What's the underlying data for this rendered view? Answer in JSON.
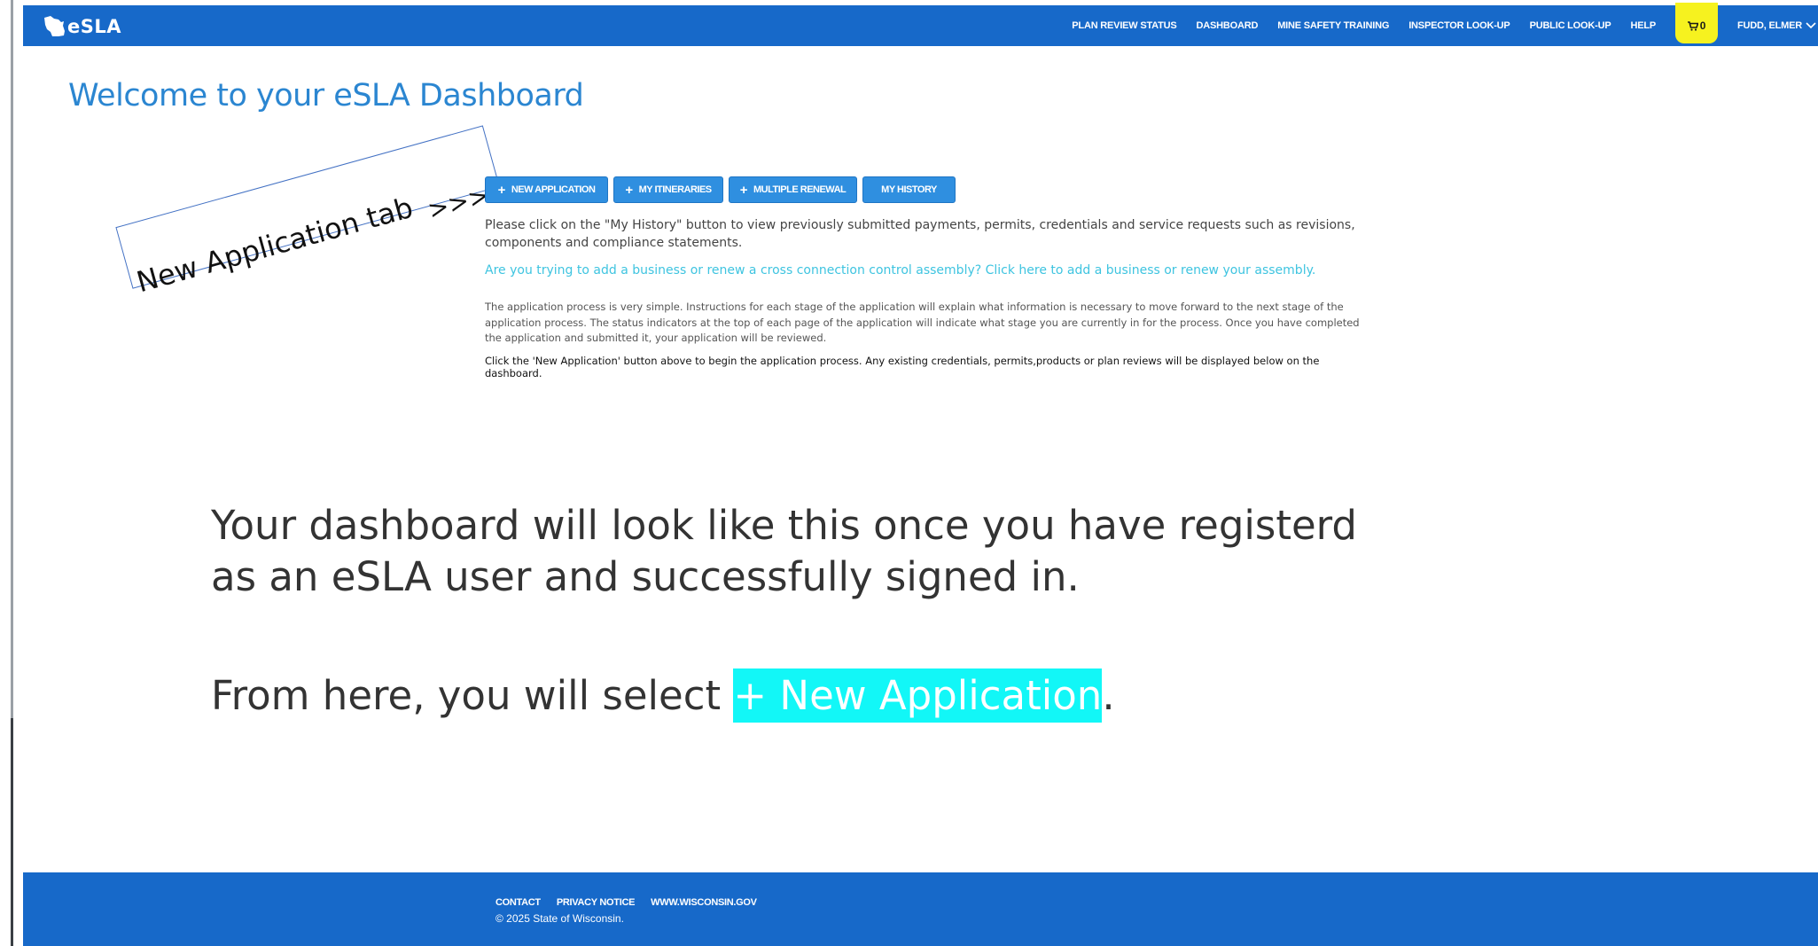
{
  "header": {
    "logo_text": "eSLA",
    "nav": [
      "PLAN REVIEW STATUS",
      "DASHBOARD",
      "MINE SAFETY TRAINING",
      "INSPECTOR LOOK-UP",
      "PUBLIC LOOK-UP",
      "HELP"
    ],
    "cart_count": "0",
    "user_name": "FUDD, ELMER",
    "brand_color": "#1769c9",
    "cart_color": "#f6f21f"
  },
  "main": {
    "title": "Welcome to your eSLA Dashboard",
    "buttons": [
      {
        "label": "NEW APPLICATION",
        "icon": "plus-icon"
      },
      {
        "label": "MY ITINERARIES",
        "icon": "plus-icon"
      },
      {
        "label": "MULTIPLE RENEWAL",
        "icon": "plus-icon"
      },
      {
        "label": "MY HISTORY",
        "icon": ""
      }
    ],
    "history_text": "Please click on the \"My History\" button to view previously submitted payments, permits, credentials and service requests such as revisions, components and compliance statements.",
    "business_link": "Are you trying to add a business or renew a cross connection control assembly? Click here to add a business or renew your assembly.",
    "process_text": "The application process is very simple. Instructions for each stage of the application will explain what information is necessary to move forward to the next stage of the application process. The status indicators at the top of each page of the application will indicate what stage you are currently in for the process. Once you have completed the application and submitted it, your application will be reviewed.",
    "click_text": "Click the 'New Application' button above to begin the application process. Any existing credentials, permits,products or plan reviews will be displayed below on the dashboard."
  },
  "annotation": {
    "callout_label": "New Application tab",
    "callout_arrow": ">>>",
    "line1": "Your dashboard will look like this once you have registerd",
    "line2": "as an eSLA user and successfully signed in.",
    "line3_prefix": "From here, you will select ",
    "line3_highlight": "+ New Application",
    "line3_suffix": ".",
    "highlight_color": "#12f7f7"
  },
  "footer": {
    "links": [
      "CONTACT",
      "PRIVACY NOTICE",
      "WWW.WISCONSIN.GOV"
    ],
    "copyright": "© 2025 State of Wisconsin."
  }
}
